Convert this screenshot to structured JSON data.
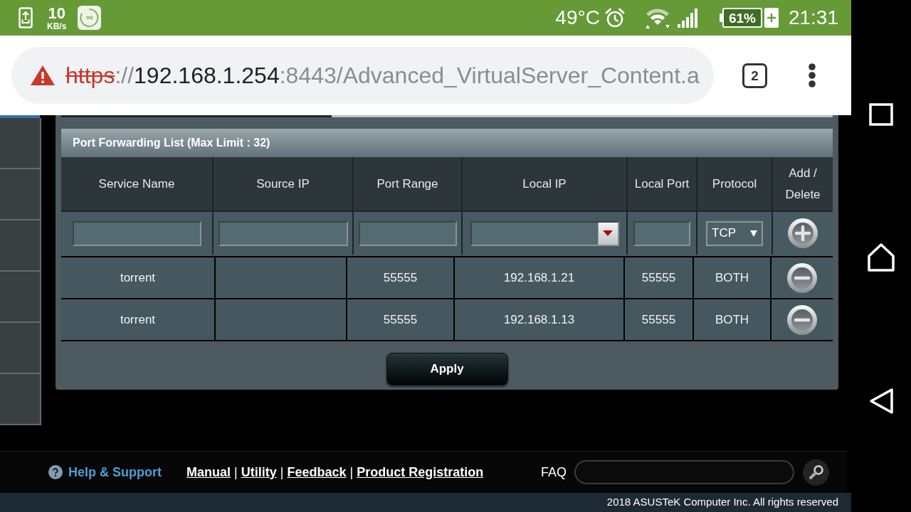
{
  "status_bar": {
    "net_speed": "10",
    "net_speed_unit": "KB/s",
    "app_icon_label": "mi",
    "temperature": "49°C",
    "battery": "61%",
    "time": "21:31"
  },
  "browser": {
    "url": [
      {
        "kind": "insecure_scheme",
        "text": "https"
      },
      {
        "kind": "muted",
        "text": "://"
      },
      {
        "kind": "host",
        "text": "192.168.1.254"
      },
      {
        "kind": "muted",
        "text": ":8443/Advanced_VirtualServer_Content.a"
      }
    ],
    "tab_count": "2"
  },
  "port_forwarding": {
    "title": "Port Forwarding List (Max Limit : 32)",
    "columns": [
      "Service Name",
      "Source IP",
      "Port Range",
      "Local IP",
      "Local Port",
      "Protocol",
      "Add / Delete"
    ],
    "new_entry": {
      "protocol": "TCP"
    },
    "rows": [
      {
        "service_name": "torrent",
        "port_range": "55555",
        "local_ip": "192.168.1.21",
        "local_port": "55555",
        "protocol": "BOTH"
      },
      {
        "service_name": "torrent",
        "port_range": "55555",
        "local_ip": "192.168.1.13",
        "local_port": "55555",
        "protocol": "BOTH"
      }
    ]
  },
  "apply_button": "Apply",
  "footer": {
    "help": "Help & Support",
    "links": [
      {
        "label": "Manual",
        "separator": "|"
      },
      {
        "label": "Utility",
        "separator": "|"
      },
      {
        "label": "Feedback",
        "separator": "|"
      },
      {
        "label": "Product Registration"
      }
    ],
    "faq_label": "FAQ",
    "copyright": "2018 ASUSTeK Computer Inc. All rights reserved"
  }
}
